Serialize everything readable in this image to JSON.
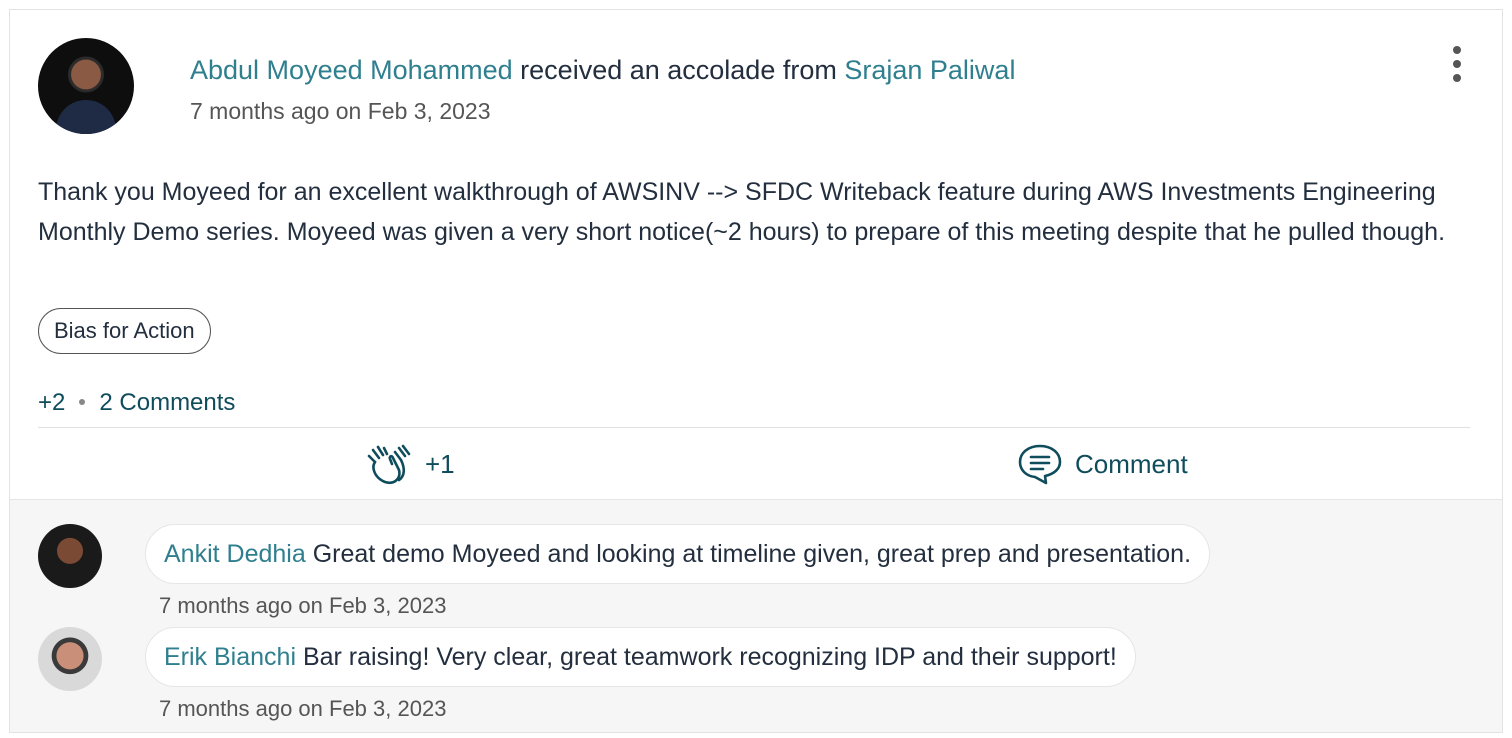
{
  "post": {
    "recipient": "Abdul Moyeed Mohammed",
    "action_text": " received an accolade from ",
    "sender": "Srajan Paliwal",
    "time": "7 months ago on Feb 3, 2023",
    "message": "Thank you Moyeed for an excellent walkthrough of AWSINV --> SFDC Writeback feature during AWS Investments Engineering Monthly Demo series. Moyeed was given a very short notice(~2 hours) to prepare of this meeting despite that he pulled though.",
    "tag": "Bias for Action",
    "reactions_count": "+2",
    "comments_count": "2 Comments",
    "like_label": "+1",
    "comment_label": "Comment"
  },
  "comments": [
    {
      "author": "Ankit Dedhia",
      "text": " Great demo Moyeed and looking at timeline given, great prep and presentation.",
      "time": "7 months ago on Feb 3, 2023"
    },
    {
      "author": "Erik Bianchi",
      "text": " Bar raising! Very clear, great teamwork recognizing IDP and their support!",
      "time": "7 months ago on Feb 3, 2023"
    }
  ],
  "icons": {
    "more": "more-vertical-icon",
    "like": "clapping-hands-icon",
    "comment": "chat-bubble-icon"
  },
  "colors": {
    "link": "#2f7f8f",
    "action": "#0f4c5c",
    "text": "#232f3e",
    "comments_bg": "#f6f6f6"
  }
}
